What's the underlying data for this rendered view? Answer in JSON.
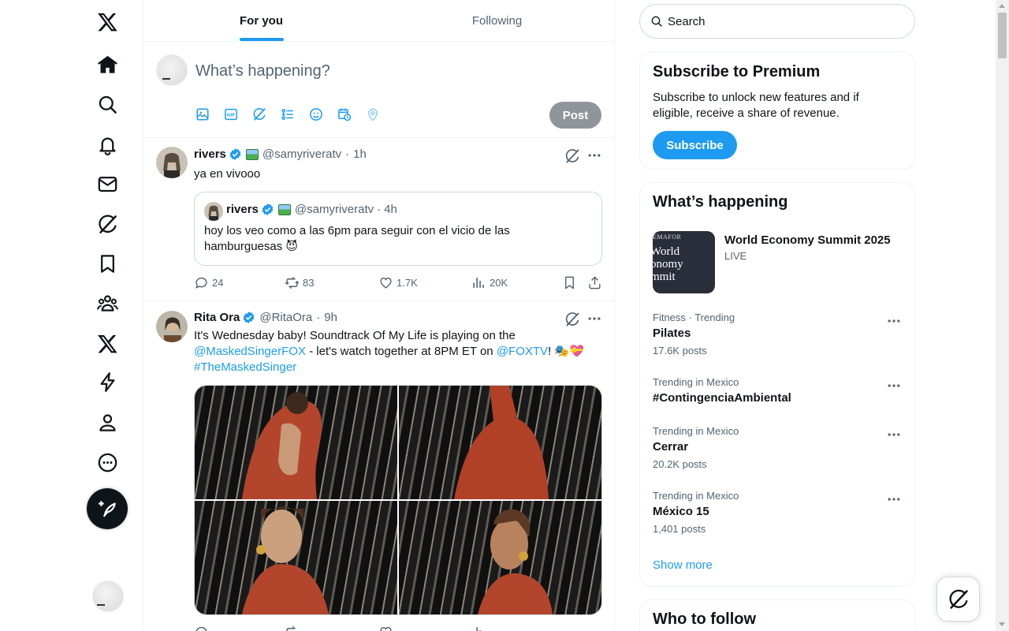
{
  "nav": {
    "items": [
      {
        "icon": "x-logo-icon"
      },
      {
        "icon": "home-icon"
      },
      {
        "icon": "search-icon"
      },
      {
        "icon": "bell-icon"
      },
      {
        "icon": "mail-icon"
      },
      {
        "icon": "grok-icon"
      },
      {
        "icon": "bookmark-icon"
      },
      {
        "icon": "communities-icon"
      },
      {
        "icon": "premium-x-icon"
      },
      {
        "icon": "lightning-icon"
      },
      {
        "icon": "profile-icon"
      },
      {
        "icon": "more-circle-icon"
      }
    ],
    "compose_icon": "feather-plus-icon"
  },
  "tabs": [
    {
      "label": "For you",
      "active": true
    },
    {
      "label": "Following",
      "active": false
    }
  ],
  "composer": {
    "placeholder": "What’s happening?",
    "post_label": "Post",
    "tools": [
      "image-icon",
      "gif-icon",
      "grok-icon",
      "poll-icon",
      "emoji-icon",
      "schedule-icon",
      "location-icon"
    ]
  },
  "tweets": [
    {
      "name": "rivers",
      "handle": "@samyriveratv",
      "time": "1h",
      "text": "ya en vivooo",
      "quote": {
        "name": "rivers",
        "handle": "@samyriveratv",
        "time": "4h",
        "text": "hoy los veo como a las 6pm para seguir con el vicio de las hamburguesas 😈"
      },
      "stats": {
        "replies": "24",
        "reposts": "83",
        "likes": "1.7K",
        "views": "20K"
      }
    },
    {
      "name": "Rita Ora",
      "handle": "@RitaOra",
      "time": "9h",
      "text_parts": {
        "t1": "It's Wednesday baby! Soundtrack Of My Life is playing on the ",
        "l1": "@MaskedSingerFOX",
        "t2": " - let's watch together at 8PM ET on ",
        "l2": "@FOXTV",
        "t3": "! 🎭💝 ",
        "l3": "#TheMaskedSinger"
      },
      "stats": {
        "replies": "",
        "reposts": "",
        "likes": "",
        "views": ""
      }
    }
  ],
  "search": {
    "placeholder": "Search"
  },
  "premium": {
    "title": "Subscribe to Premium",
    "text": "Subscribe to unlock new features and if eligible, receive a share of revenue.",
    "button": "Subscribe"
  },
  "happening": {
    "title": "What’s happening",
    "event": {
      "title": "World Economy Summit 2025",
      "status": "LIVE",
      "thumb_top": "EMAFOR",
      "thumb_text": "World\nonomy\nmmit"
    },
    "trends": [
      {
        "meta": "Fitness · Trending",
        "topic": "Pilates",
        "count": "17.6K posts"
      },
      {
        "meta": "Trending in Mexico",
        "topic": "#ContingenciaAmbiental",
        "count": ""
      },
      {
        "meta": "Trending in Mexico",
        "topic": "Cerrar",
        "count": "20.2K posts"
      },
      {
        "meta": "Trending in Mexico",
        "topic": "México 15",
        "count": "1,401 posts"
      }
    ],
    "show_more": "Show more"
  },
  "who_to_follow": {
    "title": "Who to follow"
  },
  "colors": {
    "accent": "#1d9bf0",
    "text": "#0f1419",
    "secondary": "#536471",
    "border": "#eff3f4"
  }
}
